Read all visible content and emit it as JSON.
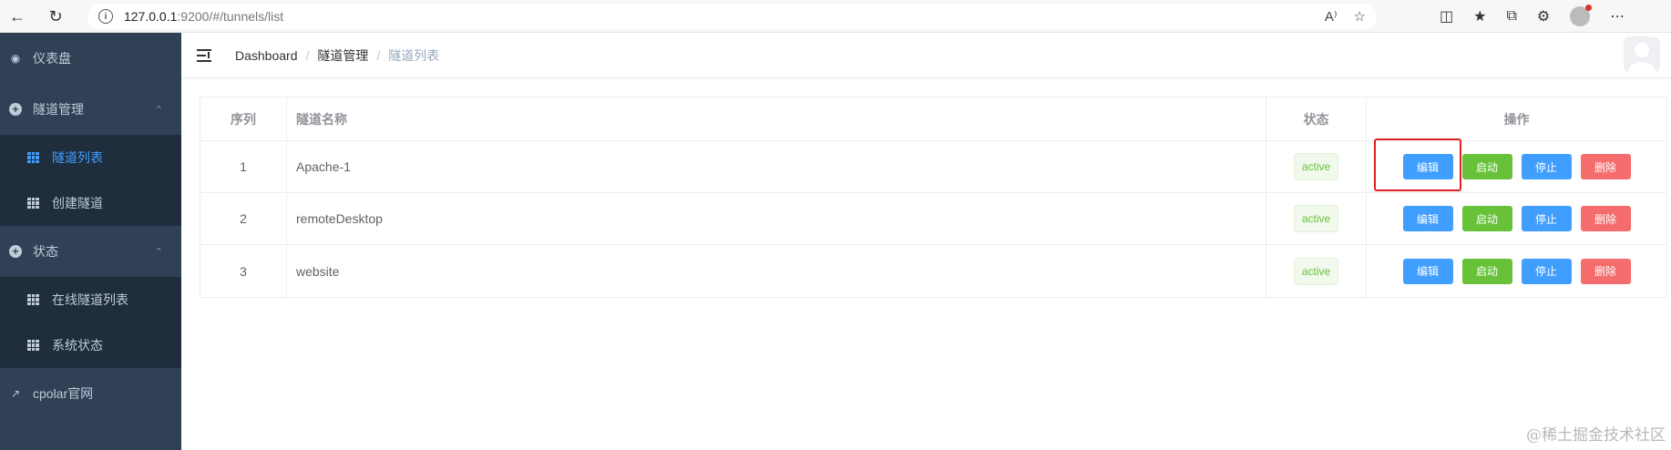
{
  "browser": {
    "url_host": "127.0.0.1",
    "url_path": ":9200/#/tunnels/list",
    "info_icon_glyph": "i"
  },
  "sidebar": {
    "items": [
      {
        "label": "仪表盘",
        "icon": "dashboard-icon"
      },
      {
        "label": "隧道管理",
        "icon": "plus-circle-icon",
        "expanded": true,
        "children": [
          {
            "label": "隧道列表",
            "active": true
          },
          {
            "label": "创建隧道"
          }
        ]
      },
      {
        "label": "状态",
        "icon": "plus-circle-icon",
        "expanded": true,
        "children": [
          {
            "label": "在线隧道列表"
          },
          {
            "label": "系统状态"
          }
        ]
      },
      {
        "label": "cpolar官网",
        "icon": "external-link-icon"
      }
    ]
  },
  "breadcrumb": [
    "Dashboard",
    "隧道管理",
    "隧道列表"
  ],
  "table": {
    "headers": [
      "序列",
      "隧道名称",
      "状态",
      "操作"
    ],
    "rows": [
      {
        "index": "1",
        "name": "Apache-1",
        "status": "active"
      },
      {
        "index": "2",
        "name": "remoteDesktop",
        "status": "active"
      },
      {
        "index": "3",
        "name": "website",
        "status": "active"
      }
    ],
    "actions": {
      "edit": "编辑",
      "start": "启动",
      "stop": "停止",
      "delete": "删除"
    }
  },
  "colors": {
    "sidebar_bg": "#304156",
    "submenu_bg": "#1f2d3d",
    "primary": "#409eff",
    "success": "#67c23a",
    "danger": "#f56c6c",
    "highlight": "#e02020"
  },
  "watermark": "@稀土掘金技术社区"
}
